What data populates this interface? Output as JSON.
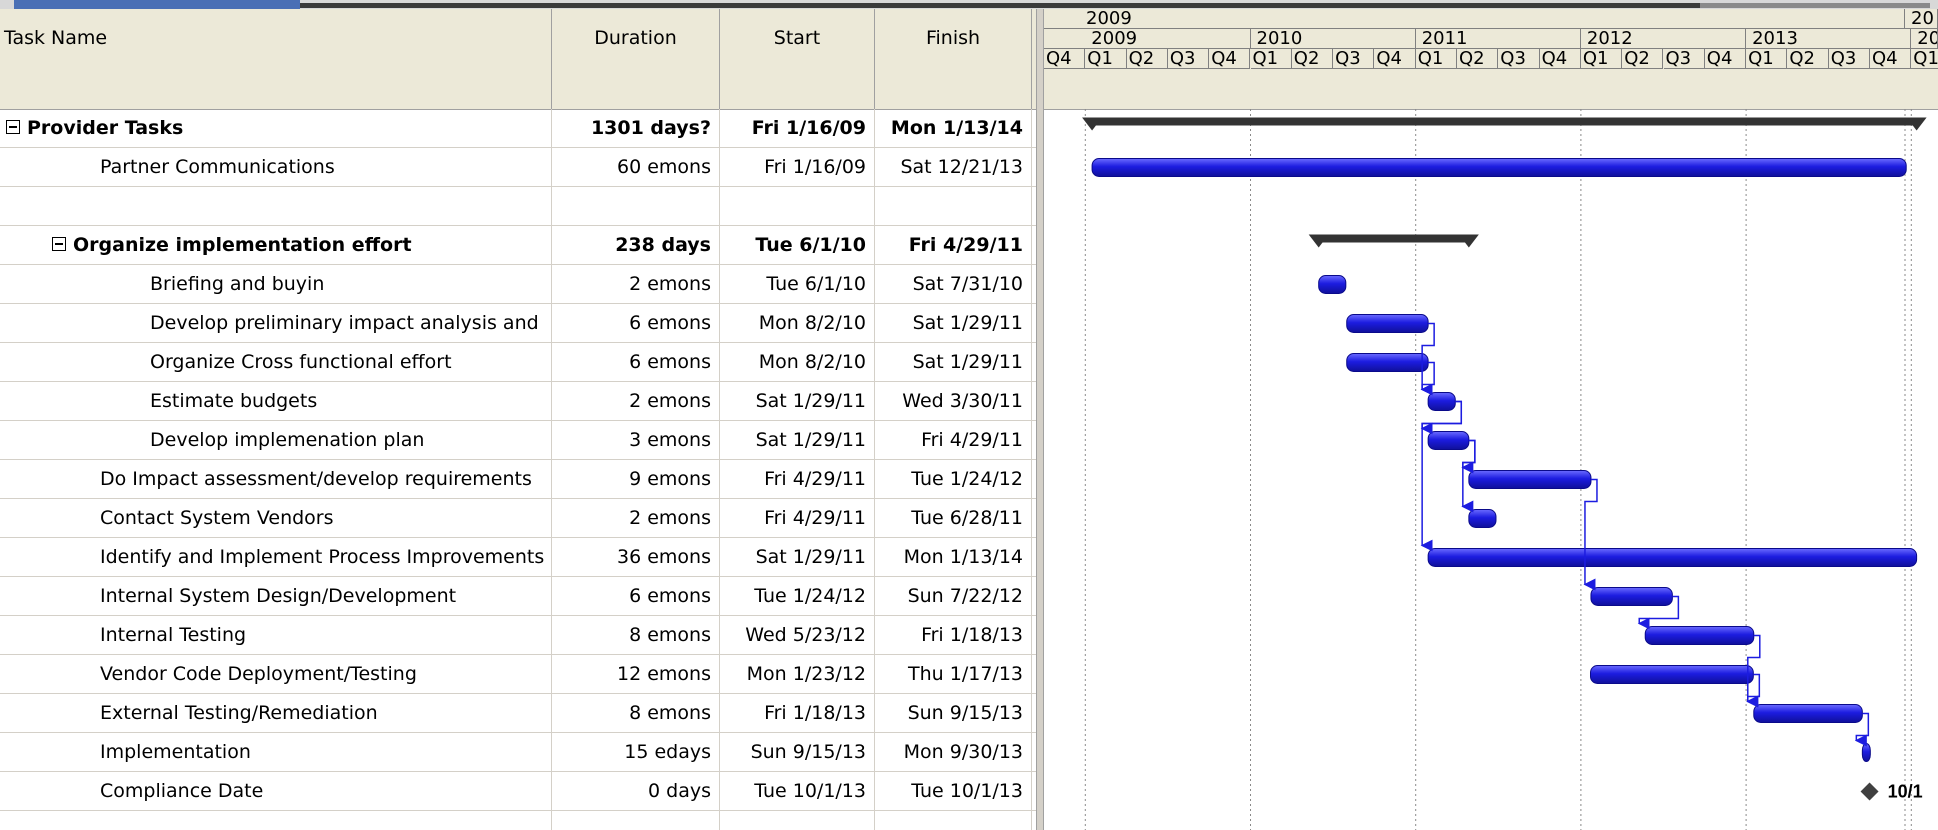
{
  "columns": {
    "name": "Task Name",
    "duration": "Duration",
    "start": "Start",
    "finish": "Finish"
  },
  "timescale": {
    "top_year": "2009",
    "top_year_next": "20",
    "years": [
      "2009",
      "2010",
      "2011",
      "2012",
      "2013",
      "20"
    ],
    "quarters": [
      "Q4",
      "Q1",
      "Q2",
      "Q3",
      "Q4",
      "Q1",
      "Q2",
      "Q3",
      "Q4",
      "Q1",
      "Q2",
      "Q3",
      "Q4",
      "Q1",
      "Q2",
      "Q3",
      "Q4",
      "Q1",
      "Q2",
      "Q3",
      "Q4",
      "Q1"
    ]
  },
  "tasks": [
    {
      "name": "Provider Tasks",
      "duration": "1301 days?",
      "start": "Fri 1/16/09",
      "finish": "Mon 1/13/14",
      "level": 0,
      "summary": true,
      "collapsible": true
    },
    {
      "name": "Partner Communications",
      "duration": "60 emons",
      "start": "Fri 1/16/09",
      "finish": "Sat 12/21/13",
      "level": 1
    },
    {
      "name": "",
      "duration": "",
      "start": "",
      "finish": "",
      "level": 1,
      "blank": true
    },
    {
      "name": "Organize implementation effort",
      "duration": "238 days",
      "start": "Tue 6/1/10",
      "finish": "Fri 4/29/11",
      "level": 1,
      "summary": true,
      "collapsible": true
    },
    {
      "name": "Briefing and buyin",
      "duration": "2 emons",
      "start": "Tue 6/1/10",
      "finish": "Sat 7/31/10",
      "level": 2
    },
    {
      "name": "Develop preliminary impact analysis and",
      "duration": "6 emons",
      "start": "Mon 8/2/10",
      "finish": "Sat 1/29/11",
      "level": 2
    },
    {
      "name": "Organize Cross functional effort",
      "duration": "6 emons",
      "start": "Mon 8/2/10",
      "finish": "Sat 1/29/11",
      "level": 2
    },
    {
      "name": "Estimate budgets",
      "duration": "2 emons",
      "start": "Sat 1/29/11",
      "finish": "Wed 3/30/11",
      "level": 2
    },
    {
      "name": "Develop implemenation plan",
      "duration": "3 emons",
      "start": "Sat 1/29/11",
      "finish": "Fri 4/29/11",
      "level": 2
    },
    {
      "name": "Do Impact assessment/develop requirements",
      "duration": "9 emons",
      "start": "Fri 4/29/11",
      "finish": "Tue 1/24/12",
      "level": 1
    },
    {
      "name": "Contact System Vendors",
      "duration": "2 emons",
      "start": "Fri 4/29/11",
      "finish": "Tue 6/28/11",
      "level": 1
    },
    {
      "name": "Identify and Implement Process Improvements",
      "duration": "36 emons",
      "start": "Sat 1/29/11",
      "finish": "Mon 1/13/14",
      "level": 1
    },
    {
      "name": "Internal System Design/Development",
      "duration": "6 emons",
      "start": "Tue 1/24/12",
      "finish": "Sun 7/22/12",
      "level": 1
    },
    {
      "name": "Internal Testing",
      "duration": "8 emons",
      "start": "Wed 5/23/12",
      "finish": "Fri 1/18/13",
      "level": 1
    },
    {
      "name": "Vendor Code Deployment/Testing",
      "duration": "12 emons",
      "start": "Mon 1/23/12",
      "finish": "Thu 1/17/13",
      "level": 1
    },
    {
      "name": "External Testing/Remediation",
      "duration": "8 emons",
      "start": "Fri 1/18/13",
      "finish": "Sun 9/15/13",
      "level": 1
    },
    {
      "name": "Implementation",
      "duration": "15 edays",
      "start": "Sun 9/15/13",
      "finish": "Mon 9/30/13",
      "level": 1
    },
    {
      "name": "Compliance Date",
      "duration": "0 days",
      "start": "Tue 10/1/13",
      "finish": "Tue 10/1/13",
      "level": 1,
      "milestone": true
    },
    {
      "name": "",
      "duration": "",
      "start": "",
      "finish": "",
      "level": 1,
      "blank": true
    }
  ],
  "milestone_label": "10/1",
  "colors": {
    "bar": "#1c1ce0",
    "bar_light": "#6b6bff",
    "summary": "#333333",
    "header": "#ece9d8",
    "grid": "#d4d0c8"
  }
}
